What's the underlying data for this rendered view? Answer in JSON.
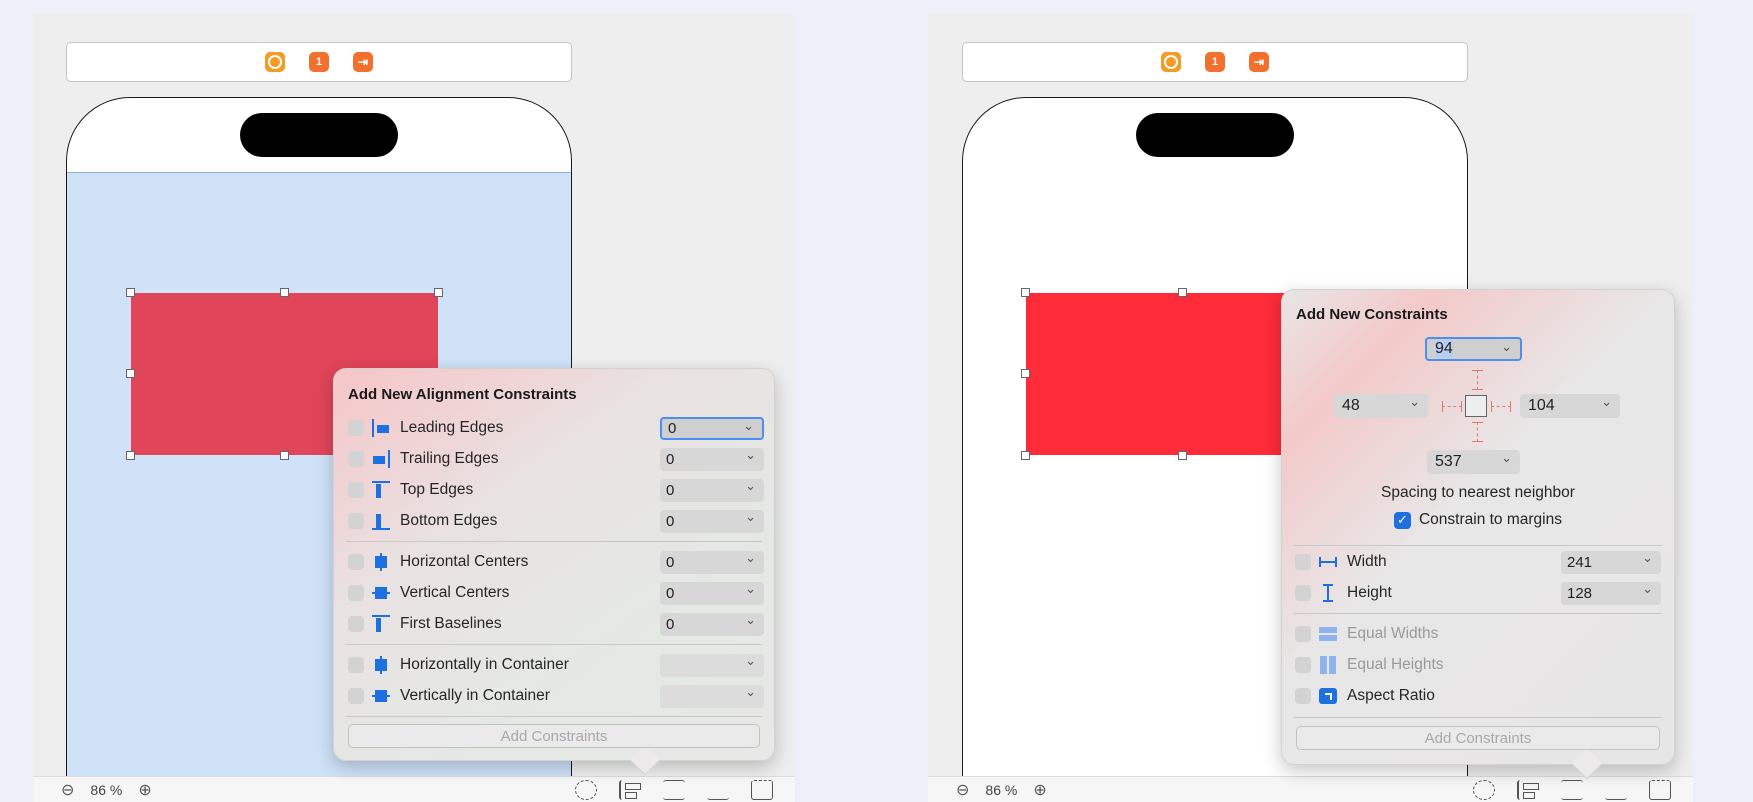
{
  "left": {
    "zoom": "86 %",
    "popover": {
      "title": "Add New Alignment Constraints",
      "rows": [
        {
          "label": "Leading Edges",
          "value": "0"
        },
        {
          "label": "Trailing Edges",
          "value": "0"
        },
        {
          "label": "Top Edges",
          "value": "0"
        },
        {
          "label": "Bottom Edges",
          "value": "0"
        },
        {
          "label": "Horizontal Centers",
          "value": "0"
        },
        {
          "label": "Vertical Centers",
          "value": "0"
        },
        {
          "label": "First Baselines",
          "value": "0"
        },
        {
          "label": "Horizontally in Container",
          "value": ""
        },
        {
          "label": "Vertically in Container",
          "value": ""
        }
      ],
      "add_button": "Add Constraints"
    }
  },
  "right": {
    "zoom": "86 %",
    "popover": {
      "title": "Add New Constraints",
      "top": "94",
      "leading": "48",
      "trailing": "104",
      "bottom": "537",
      "spacing_label": "Spacing to nearest neighbor",
      "constrain_margins": "Constrain to margins",
      "width_label": "Width",
      "width_value": "241",
      "height_label": "Height",
      "height_value": "128",
      "equal_widths": "Equal Widths",
      "equal_heights": "Equal Heights",
      "aspect_ratio": "Aspect Ratio",
      "add_button": "Add Constraints"
    }
  },
  "dock_badge": "1",
  "colors": {
    "accent": "#1e6fe0",
    "red_view_left": "#e0455a",
    "red_view_right": "#fd2c38",
    "safe_area": "#cfe2f8"
  }
}
